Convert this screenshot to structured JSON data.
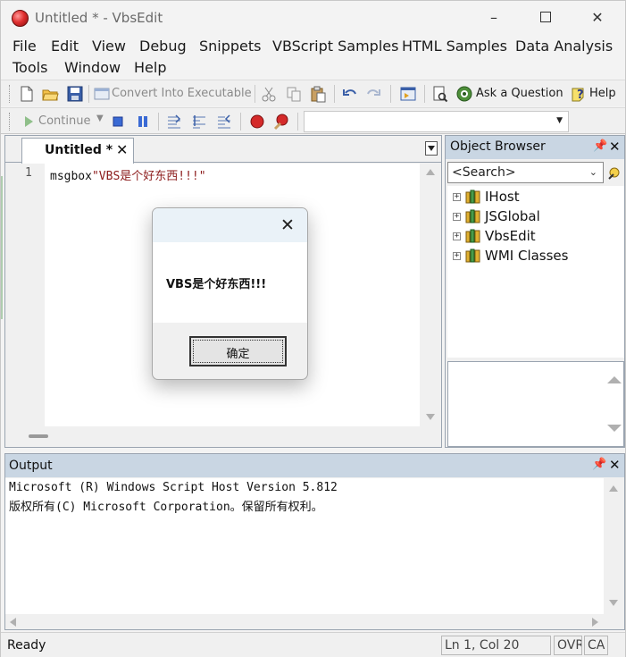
{
  "window": {
    "title": "Untitled * - VbsEdit"
  },
  "menu": [
    "File",
    "Edit",
    "View",
    "Debug",
    "Snippets",
    "VBScript Samples",
    "HTML Samples",
    "Data Analysis",
    "Tools",
    "Window",
    "Help"
  ],
  "toolbar1": {
    "convert_label": "Convert Into Executable",
    "ask_label": "Ask a Question",
    "help_label": "Help"
  },
  "toolbar2": {
    "continue_label": "Continue",
    "combo_value": ""
  },
  "editor": {
    "tab_label": "Untitled *",
    "line_number": "1",
    "code_keyword": "msgbox",
    "code_string": "\"VBS是个好东西!!!\""
  },
  "object_browser": {
    "title": "Object Browser",
    "search_placeholder": "<Search>",
    "items": [
      "IHost",
      "JSGlobal",
      "VbsEdit",
      "WMI Classes"
    ]
  },
  "output": {
    "title": "Output",
    "lines": [
      "Microsoft (R) Windows Script Host Version 5.812",
      "版权所有(C) Microsoft Corporation。保留所有权利。"
    ]
  },
  "status": {
    "text": "Ready",
    "position": "Ln 1, Col 20",
    "ovr": "OVR",
    "caps": "CA"
  },
  "msgbox": {
    "message": "VBS是个好东西!!!",
    "ok_label": "确定"
  },
  "colors": {
    "panel_header": "#c9d6e3",
    "code_string": "#8b1a1a",
    "app_icon": "#e03030"
  }
}
